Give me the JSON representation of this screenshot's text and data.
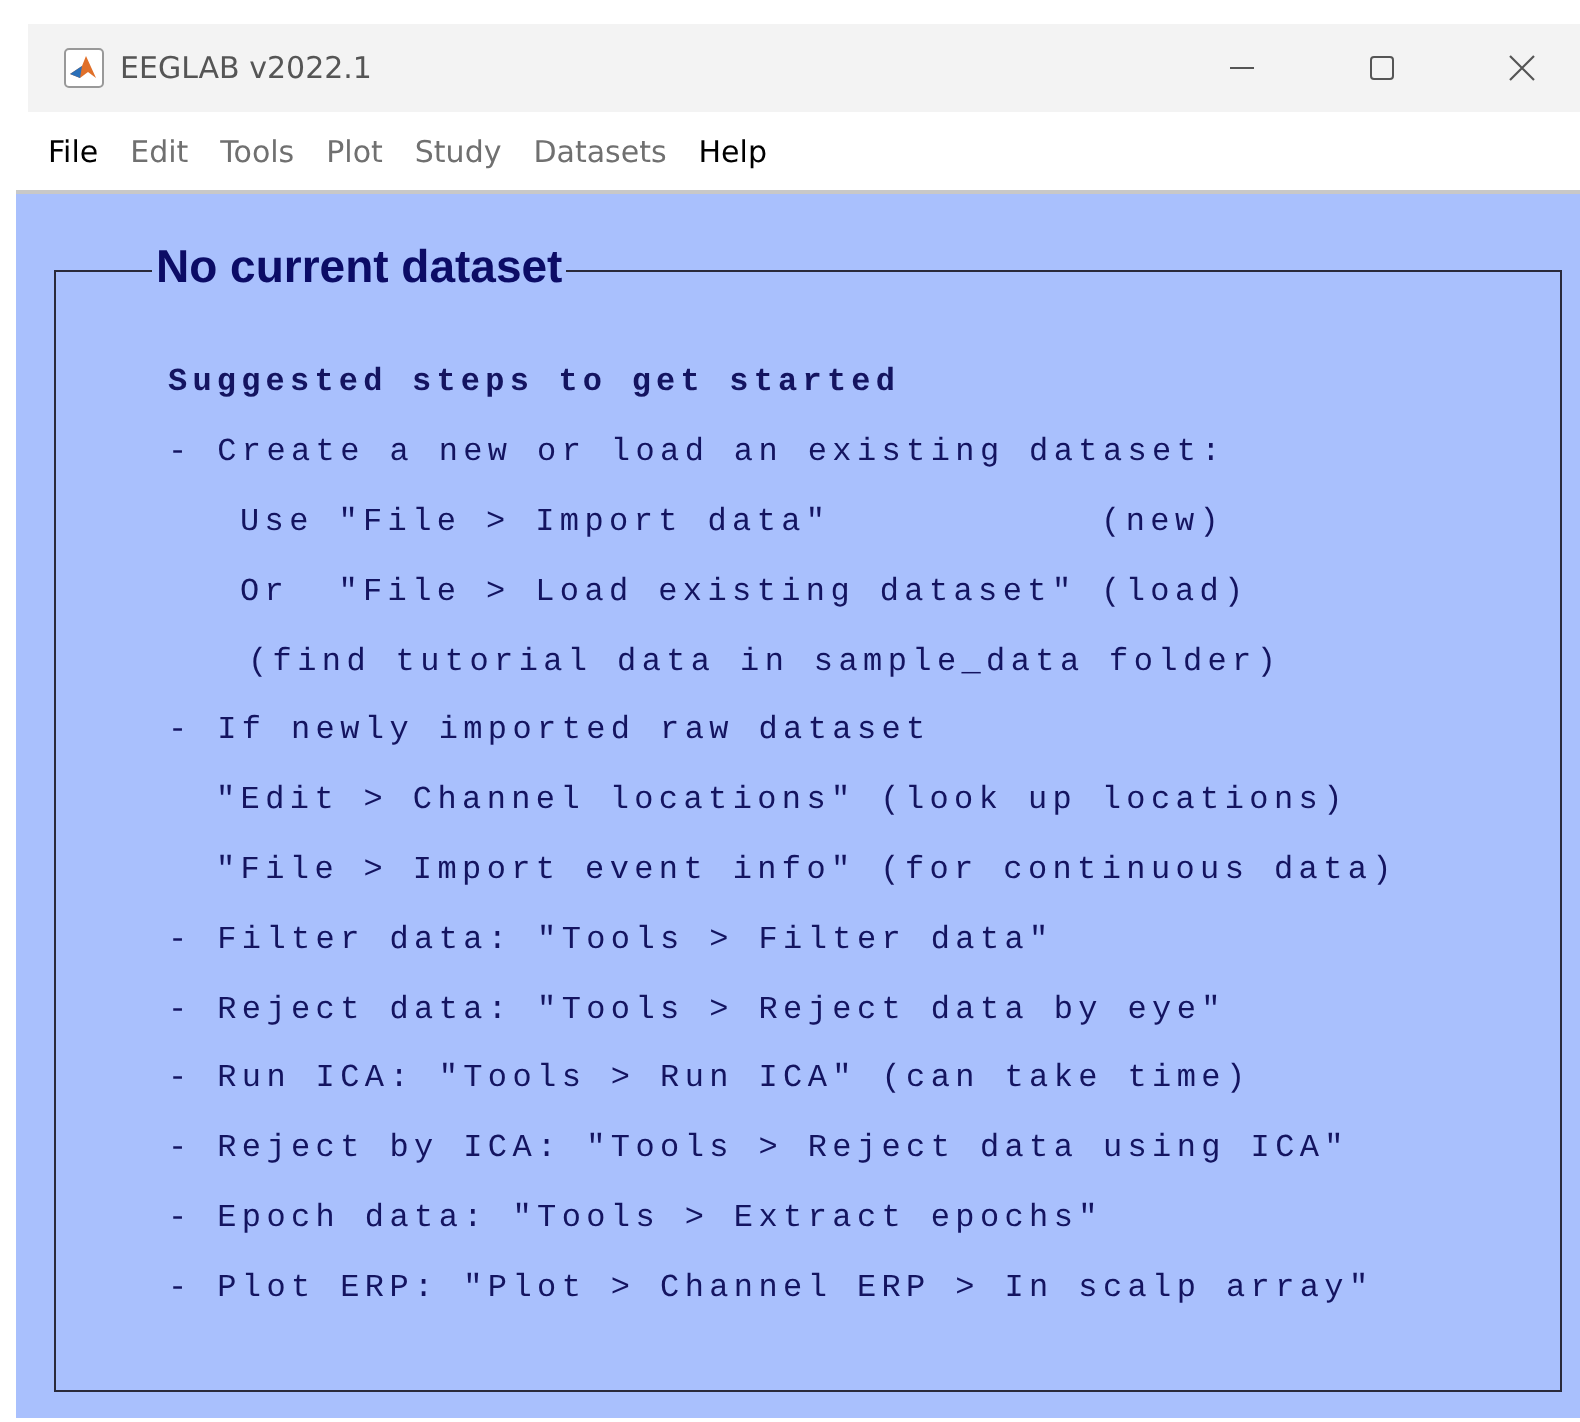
{
  "window": {
    "title": "EEGLAB v2022.1"
  },
  "menu": [
    {
      "label": "File",
      "disabled": false
    },
    {
      "label": "Edit",
      "disabled": true
    },
    {
      "label": "Tools",
      "disabled": true
    },
    {
      "label": "Plot",
      "disabled": true
    },
    {
      "label": "Study",
      "disabled": true
    },
    {
      "label": "Datasets",
      "disabled": true
    },
    {
      "label": "Help",
      "disabled": false
    }
  ],
  "panel": {
    "title": "No current dataset",
    "lines": [
      {
        "kind": "heading",
        "text": "Suggested steps to get started"
      },
      {
        "kind": "step",
        "text": "- Create a new or load an existing dataset:"
      },
      {
        "kind": "option",
        "text": "Use \"File > Import data\"           (new)"
      },
      {
        "kind": "option",
        "text": "Or  \"File > Load existing dataset\" (load)"
      },
      {
        "kind": "note",
        "text": "(find tutorial data in sample_data folder)"
      },
      {
        "kind": "step",
        "text": "- If newly imported raw dataset"
      },
      {
        "kind": "detail",
        "text": "\"Edit > Channel locations\" (look up locations)"
      },
      {
        "kind": "detail",
        "text": "\"File > Import event info\" (for continuous data)"
      },
      {
        "kind": "step",
        "text": "- Filter data: \"Tools > Filter data\""
      },
      {
        "kind": "step",
        "text": "- Reject data: \"Tools > Reject data by eye\""
      },
      {
        "kind": "step",
        "text": "- Run ICA: \"Tools > Run ICA\" (can take time)"
      },
      {
        "kind": "step",
        "text": "- Reject by ICA: \"Tools > Reject data using ICA\""
      },
      {
        "kind": "step",
        "text": "- Epoch data: \"Tools > Extract epochs\""
      },
      {
        "kind": "step",
        "text": "- Plot ERP: \"Plot > Channel ERP > In scalp array\""
      }
    ]
  }
}
